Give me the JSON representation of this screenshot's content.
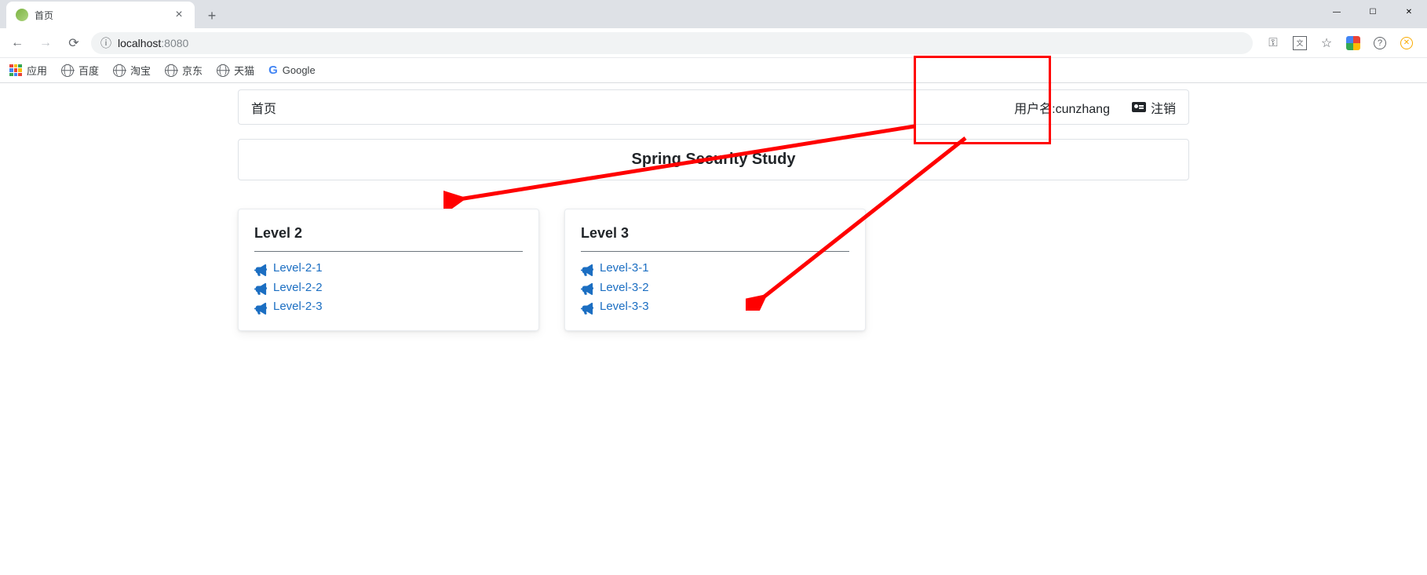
{
  "browser": {
    "tab_title": "首页",
    "url_host": "localhost",
    "url_port": ":8080",
    "bookmarks": {
      "apps": "应用",
      "items": [
        "百度",
        "淘宝",
        "京东",
        "天猫",
        "Google"
      ]
    }
  },
  "page": {
    "home_label": "首页",
    "username_label": "用户名:cunzhang",
    "logout_label": "注销",
    "title": "Spring Security Study",
    "cards": [
      {
        "title": "Level 2",
        "links": [
          "Level-2-1",
          "Level-2-2",
          "Level-2-3"
        ]
      },
      {
        "title": "Level 3",
        "links": [
          "Level-3-1",
          "Level-3-2",
          "Level-3-3"
        ]
      }
    ]
  }
}
